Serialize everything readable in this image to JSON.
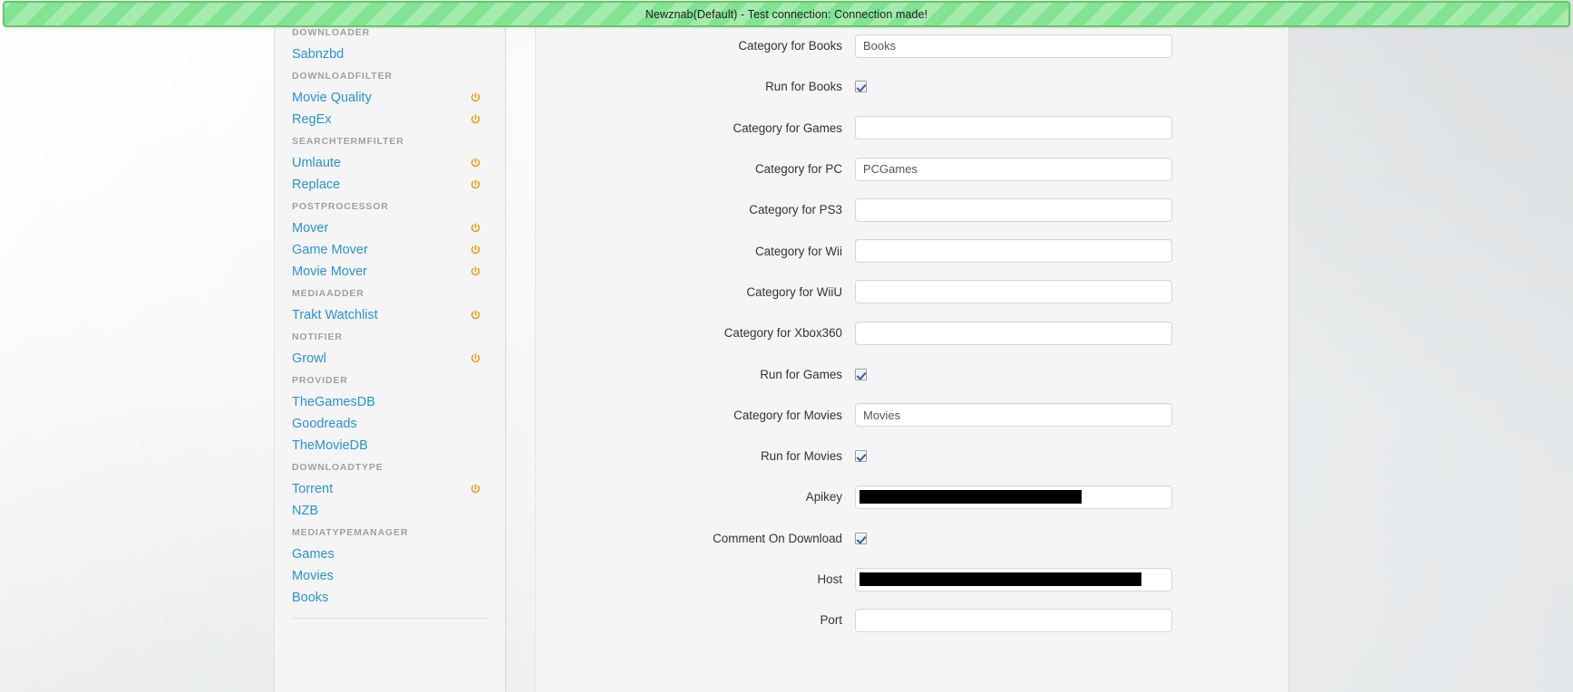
{
  "banner": {
    "message": "Newznab(Default) - Test connection: Connection made!",
    "color": "#82e392",
    "border_color": "#5fcb63"
  },
  "sidebar": {
    "partial_top_item": "( )",
    "accent_link_color": "#2a92d4",
    "power_icon_color": "#f29400",
    "groups": [
      {
        "header": "DOWNLOADER",
        "items": [
          {
            "label": "Sabnzbd",
            "power": false
          }
        ]
      },
      {
        "header": "DOWNLOADFILTER",
        "items": [
          {
            "label": "Movie Quality",
            "power": true
          },
          {
            "label": "RegEx",
            "power": true
          }
        ]
      },
      {
        "header": "SEARCHTERMFILTER",
        "items": [
          {
            "label": "Umlaute",
            "power": true
          },
          {
            "label": "Replace",
            "power": true
          }
        ]
      },
      {
        "header": "POSTPROCESSOR",
        "items": [
          {
            "label": "Mover",
            "power": true
          },
          {
            "label": "Game Mover",
            "power": true
          },
          {
            "label": "Movie Mover",
            "power": true
          }
        ]
      },
      {
        "header": "MEDIAADDER",
        "items": [
          {
            "label": "Trakt Watchlist",
            "power": true
          }
        ]
      },
      {
        "header": "NOTIFIER",
        "items": [
          {
            "label": "Growl",
            "power": true
          }
        ]
      },
      {
        "header": "PROVIDER",
        "items": [
          {
            "label": "TheGamesDB",
            "power": false
          },
          {
            "label": "Goodreads",
            "power": false
          },
          {
            "label": "TheMovieDB",
            "power": false
          }
        ]
      },
      {
        "header": "DOWNLOADTYPE",
        "items": [
          {
            "label": "Torrent",
            "power": true
          },
          {
            "label": "NZB",
            "power": false
          }
        ]
      },
      {
        "header": "MEDIATYPEMANAGER",
        "items": [
          {
            "label": "Games",
            "power": false
          },
          {
            "label": "Movies",
            "power": false
          },
          {
            "label": "Books",
            "power": false
          }
        ]
      }
    ]
  },
  "form": {
    "fields": [
      {
        "label": "Category for Books",
        "type": "text",
        "value": "Books"
      },
      {
        "label": "Run for Books",
        "type": "checkbox",
        "checked": true
      },
      {
        "label": "Category for Games",
        "type": "text",
        "value": ""
      },
      {
        "label": "Category for PC",
        "type": "text",
        "value": "PCGames"
      },
      {
        "label": "Category for PS3",
        "type": "text",
        "value": ""
      },
      {
        "label": "Category for Wii",
        "type": "text",
        "value": ""
      },
      {
        "label": "Category for WiiU",
        "type": "text",
        "value": ""
      },
      {
        "label": "Category for Xbox360",
        "type": "text",
        "value": ""
      },
      {
        "label": "Run for Games",
        "type": "checkbox",
        "checked": true
      },
      {
        "label": "Category for Movies",
        "type": "text",
        "value": "Movies"
      },
      {
        "label": "Run for Movies",
        "type": "checkbox",
        "checked": true
      },
      {
        "label": "Apikey",
        "type": "text",
        "value": "",
        "redacted": "api"
      },
      {
        "label": "Comment On Download",
        "type": "checkbox",
        "checked": true
      },
      {
        "label": "Host",
        "type": "text",
        "value": "",
        "redacted": "host"
      },
      {
        "label": "Port",
        "type": "text",
        "value": ""
      }
    ]
  }
}
